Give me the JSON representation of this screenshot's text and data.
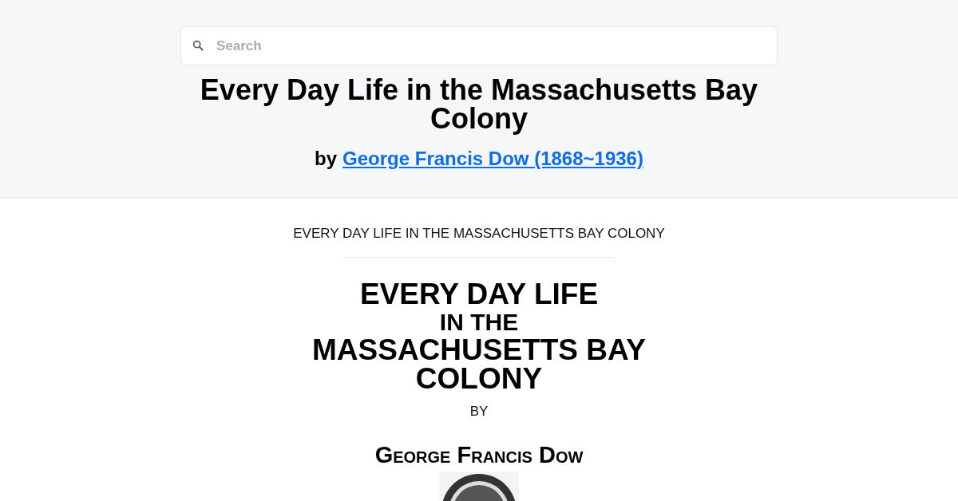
{
  "header": {
    "search": {
      "placeholder": "Search"
    },
    "title": "Every Day Life in the Massachusetts Bay Colony",
    "byline": {
      "prefix": "by",
      "author_link": "George Francis Dow (1868~1936)"
    }
  },
  "content": {
    "running_title": "EVERY DAY LIFE IN THE MASSACHUSETTS BAY COLONY",
    "title_lines": [
      {
        "text": "EVERY DAY LIFE",
        "kind": "large"
      },
      {
        "text": "IN THE",
        "kind": "medium"
      },
      {
        "text": "MASSACHUSETTS BAY COLONY",
        "kind": "large"
      }
    ],
    "by": "BY",
    "author": "George Francis Dow"
  }
}
